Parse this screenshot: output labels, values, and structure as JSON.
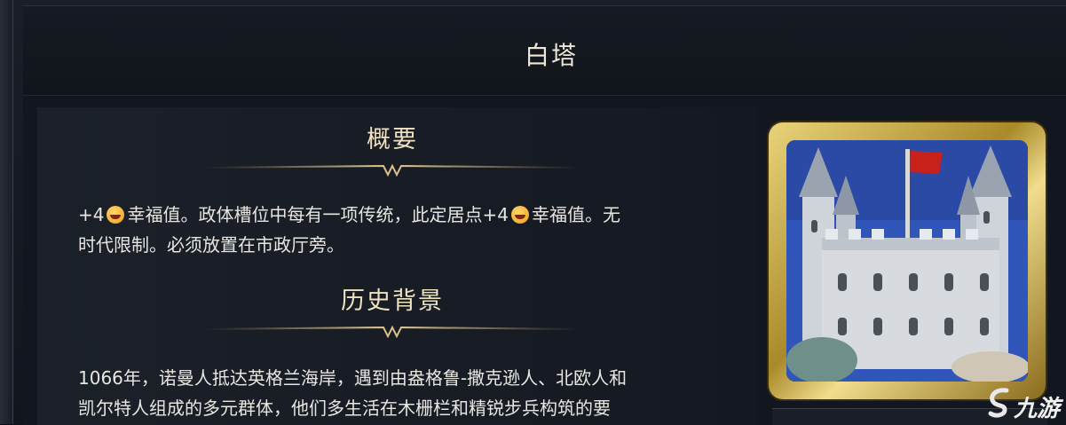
{
  "building": {
    "title": "白塔"
  },
  "sections": {
    "overview": {
      "heading": "概要",
      "line1_a": "+4",
      "line1_b": "幸福值。政体槽位中每有一项传统，此定居点+4",
      "line1_c": "幸福值。无",
      "line2": "时代限制。必须放置在市政厅旁。"
    },
    "history": {
      "heading": "历史背景",
      "line1": "1066年，诺曼人抵达英格兰海岸，遇到由盎格鲁-撒克逊人、北欧人和",
      "line2": "凯尔特人组成的多元群体，他们多生活在木栅栏和精锐步兵构筑的要"
    }
  },
  "watermark": {
    "text": "九游"
  },
  "icons": {
    "happiness": "happiness-emoji-icon",
    "portrait": "white-tower-portrait"
  },
  "colors": {
    "heading": "#efe2c0",
    "body_text": "#e8e6e1",
    "gold_frame": "#c9ab4a",
    "sky": "#2f56b8",
    "flag": "#c8201a"
  }
}
